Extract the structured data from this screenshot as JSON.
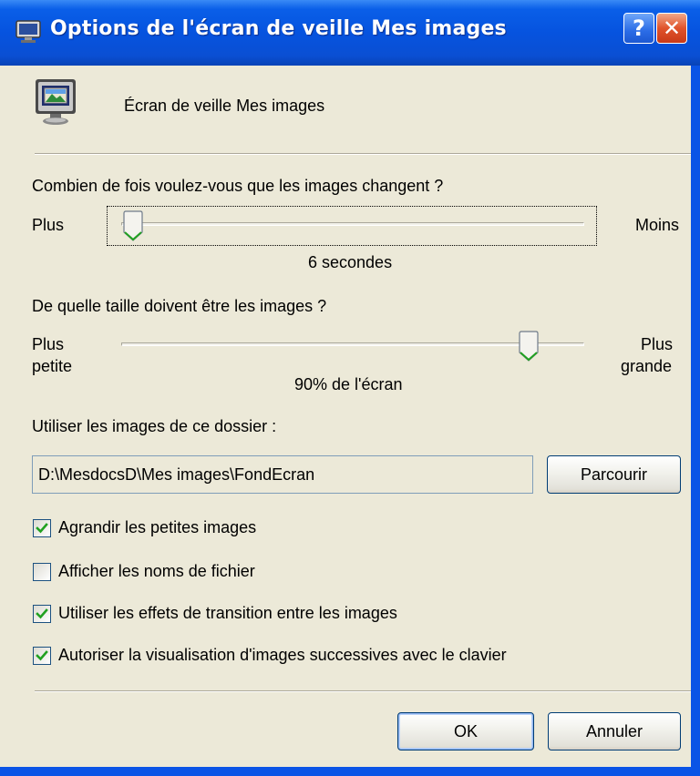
{
  "titlebar": {
    "title": "Options de l'écran de veille Mes images",
    "help_label": "?",
    "close_label": "✕"
  },
  "header": {
    "name": "Écran de veille Mes images"
  },
  "frequency": {
    "question": "Combien de fois voulez-vous que les images changent ?",
    "left_label": "Plus",
    "right_label": "Moins",
    "value_text": "6 secondes",
    "slider_fraction": 0.0
  },
  "size": {
    "question": "De quelle taille doivent être les images ?",
    "left_label_line1": "Plus",
    "left_label_line2": "petite",
    "right_label_line1": "Plus",
    "right_label_line2": "grande",
    "value_text": "90% de l'écran",
    "slider_fraction": 0.9
  },
  "folder": {
    "label": "Utiliser les images de ce dossier :",
    "path": "D:\\MesdocsD\\Mes images\\FondEcran",
    "browse_label": "Parcourir"
  },
  "options": [
    {
      "label": "Agrandir les petites images",
      "checked": true
    },
    {
      "label": "Afficher les noms de fichier",
      "checked": false
    },
    {
      "label": "Utiliser les effets de transition entre les images",
      "checked": true
    },
    {
      "label": "Autoriser la visualisation d'images successives avec le clavier",
      "checked": true
    }
  ],
  "buttons": {
    "ok_label": "OK",
    "cancel_label": "Annuler"
  },
  "colors": {
    "titlebar": "#0A54E6",
    "dialog_bg": "#ECE9D8",
    "checkmark": "#21A121",
    "thumb_accent": "#21A121"
  }
}
